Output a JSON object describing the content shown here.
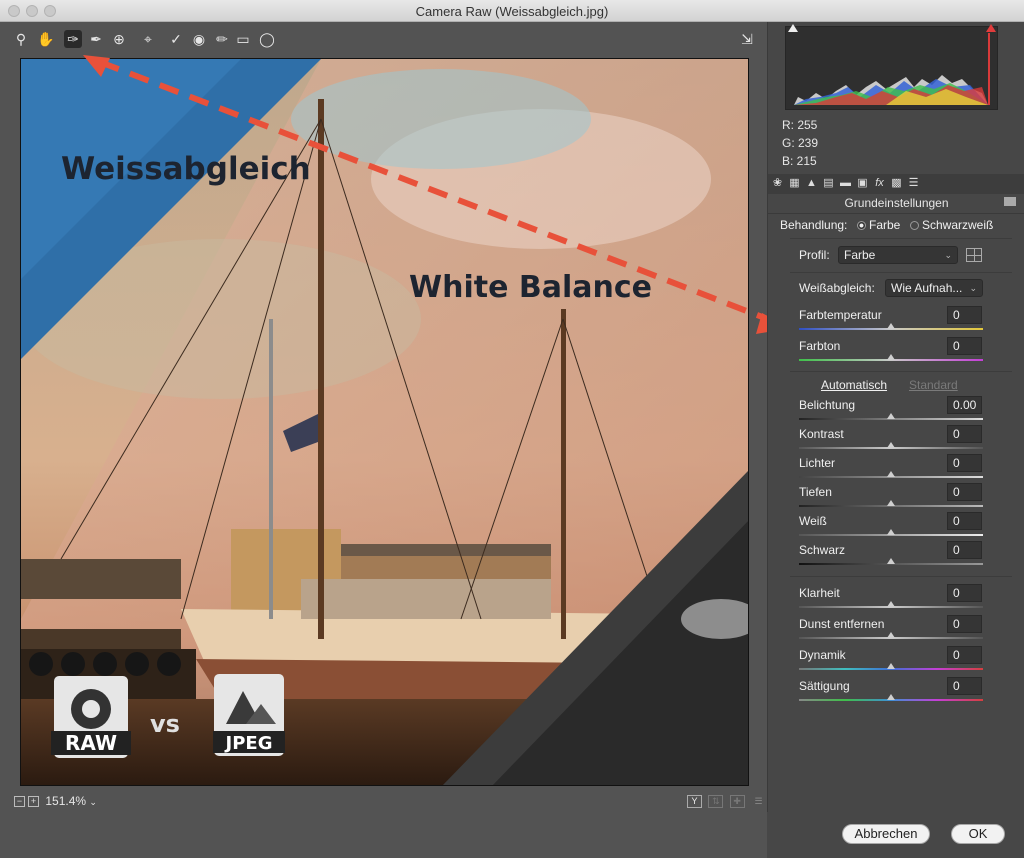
{
  "window": {
    "title": "Camera Raw (Weissabgleich.jpg)"
  },
  "toolbar": {
    "tools": [
      "zoom-tool",
      "hand-tool",
      "white-balance-tool",
      "color-sampler-tool",
      "targeted-adjustment-tool",
      "crop-tool",
      "spot-removal-tool",
      "red-eye-tool",
      "adjustment-brush-tool",
      "graduated-filter-tool",
      "radial-filter-tool"
    ],
    "export_icon": "open-preferences-icon"
  },
  "image": {
    "overlay_text_1": "Weissabgleich",
    "overlay_text_2": "White Balance",
    "raw_label": "RAW",
    "vs_label": "vs",
    "jpeg_label": "JPEG"
  },
  "status": {
    "zoom": "151.4%",
    "view_mode": "Y"
  },
  "readout": {
    "r": "R:  255",
    "g": "G:  239",
    "b": "B:  215"
  },
  "panel": {
    "title": "Grundeinstellungen",
    "treatment_label": "Behandlung:",
    "treatment_color": "Farbe",
    "treatment_bw": "Schwarzweiß",
    "profile_label": "Profil:",
    "profile_value": "Farbe",
    "wb_label": "Weißabgleich:",
    "wb_value": "Wie Aufnah...",
    "auto_link": "Automatisch",
    "default_link": "Standard",
    "sliders": [
      {
        "label": "Farbtemperatur",
        "value": "0",
        "position": 0.5
      },
      {
        "label": "Farbton",
        "value": "0",
        "position": 0.5
      },
      {
        "label": "Belichtung",
        "value": "0.00",
        "position": 0.5
      },
      {
        "label": "Kontrast",
        "value": "0",
        "position": 0.5
      },
      {
        "label": "Lichter",
        "value": "0",
        "position": 0.5
      },
      {
        "label": "Tiefen",
        "value": "0",
        "position": 0.5
      },
      {
        "label": "Weiß",
        "value": "0",
        "position": 0.5
      },
      {
        "label": "Schwarz",
        "value": "0",
        "position": 0.5
      },
      {
        "label": "Klarheit",
        "value": "0",
        "position": 0.5
      },
      {
        "label": "Dunst entfernen",
        "value": "0",
        "position": 0.5
      },
      {
        "label": "Dynamik",
        "value": "0",
        "position": 0.5
      },
      {
        "label": "Sättigung",
        "value": "0",
        "position": 0.5
      }
    ]
  },
  "buttons": {
    "cancel": "Abbrechen",
    "ok": "OK"
  },
  "colors": {
    "accent_arrow": "#e8513a",
    "panel_bg": "#474747"
  }
}
